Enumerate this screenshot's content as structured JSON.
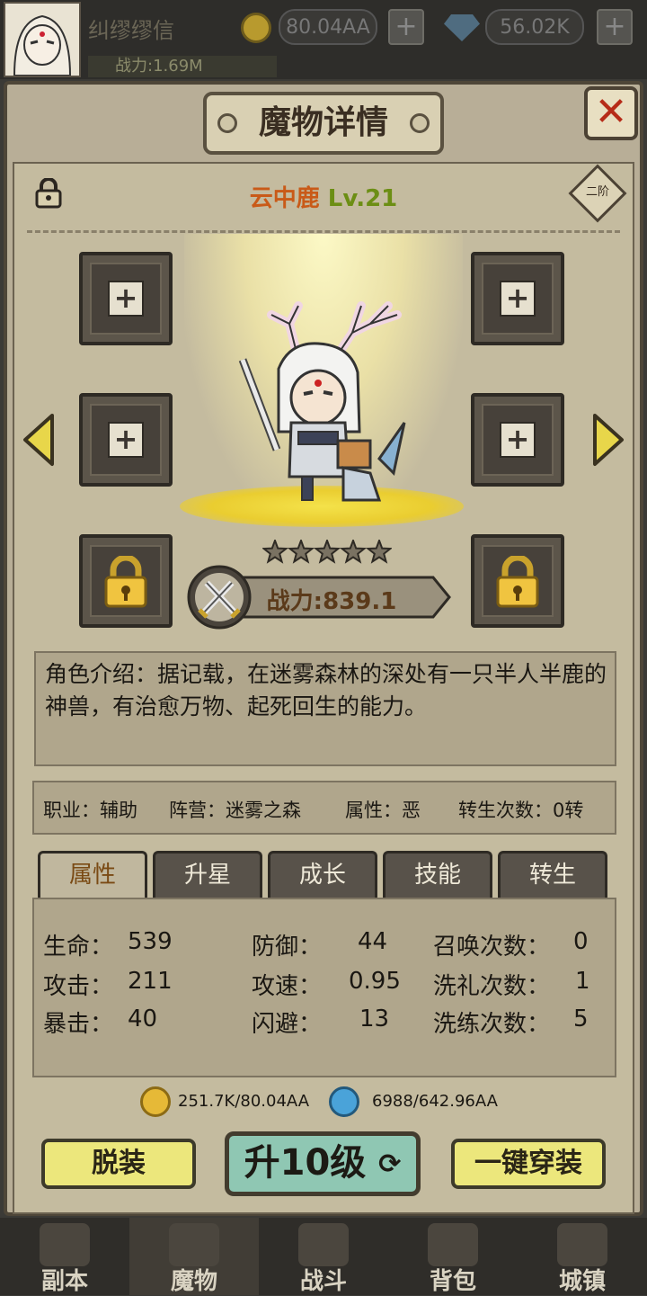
{
  "top": {
    "player_name": "纠缪缪信",
    "power_label": "战力:1.69M",
    "gold": "80.04AA",
    "gems": "56.02K",
    "plus": "+"
  },
  "panel": {
    "title": "魔物详情",
    "close": "✕",
    "monster_name": "云中鹿",
    "monster_level": "Lv.21",
    "stage": "二阶",
    "slot_plus": "+",
    "stars": 5,
    "power": "战力:839.1"
  },
  "intro": {
    "text": "角色介绍：据记载，在迷雾森林的深处有一只半人半鹿的神兽，有治愈万物、起死回生的能力。"
  },
  "info": {
    "job": "职业：辅助",
    "camp": "阵营：迷雾之森",
    "attr": "属性：恶",
    "rebirth": "转生次数：0转"
  },
  "tabs": [
    "属性",
    "升星",
    "成长",
    "技能",
    "转生"
  ],
  "stats": {
    "hp_label": "生命：",
    "hp": "539",
    "atk_label": "攻击：",
    "atk": "211",
    "crit_label": "暴击：",
    "crit": "40",
    "def_label": "防御：",
    "def": "44",
    "spd_label": "攻速：",
    "spd": "0.95",
    "eva_label": "闪避：",
    "eva": "13",
    "summon_label": "召唤次数：",
    "summon": "0",
    "bless_label": "洗礼次数：",
    "bless": "1",
    "refine_label": "洗练次数：",
    "refine": "5"
  },
  "resources": {
    "gold": "251.7K/80.04AA",
    "exp": "6988/642.96AA"
  },
  "buttons": {
    "unequip": "脱装",
    "upgrade": "升10级",
    "auto_equip": "一键穿装"
  },
  "nav": [
    "副本",
    "魔物",
    "战斗",
    "背包",
    "城镇"
  ],
  "colors": {
    "accent_orange": "#c95a18",
    "level_green": "#6c8e14",
    "button_yellow": "#ece77c",
    "upgrade_teal": "#8fc7b3",
    "close_red": "#b62b18"
  }
}
